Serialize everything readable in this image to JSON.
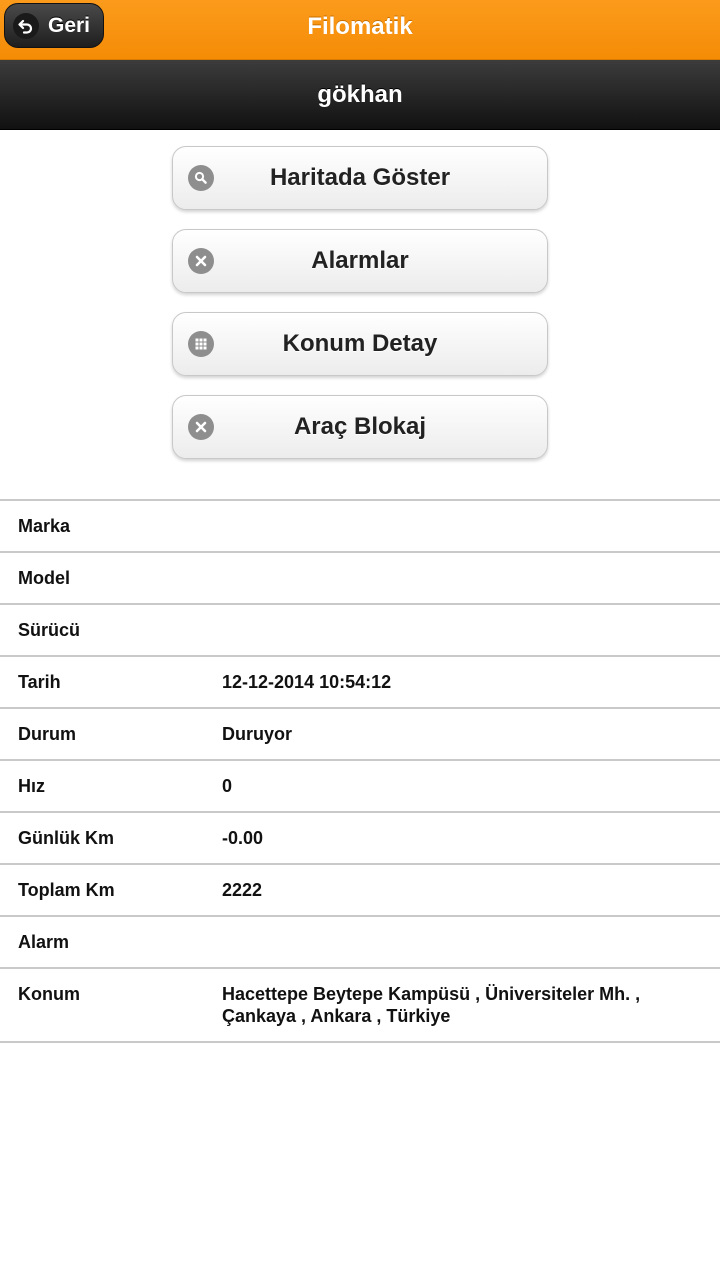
{
  "header": {
    "back_label": "Geri",
    "app_title": "Filomatik"
  },
  "subheader": {
    "title": "gökhan"
  },
  "actions": [
    {
      "label": "Haritada Göster",
      "icon": "search-icon"
    },
    {
      "label": "Alarmlar",
      "icon": "close-icon"
    },
    {
      "label": "Konum Detay",
      "icon": "grid-icon"
    },
    {
      "label": "Araç Blokaj",
      "icon": "close-icon"
    }
  ],
  "details": [
    {
      "label": "Marka",
      "value": ""
    },
    {
      "label": "Model",
      "value": ""
    },
    {
      "label": "Sürücü",
      "value": ""
    },
    {
      "label": "Tarih",
      "value": "12-12-2014 10:54:12"
    },
    {
      "label": "Durum",
      "value": "Duruyor"
    },
    {
      "label": "Hız",
      "value": "0"
    },
    {
      "label": "Günlük Km",
      "value": "-0.00"
    },
    {
      "label": "Toplam Km",
      "value": "2222"
    },
    {
      "label": "Alarm",
      "value": ""
    },
    {
      "label": "Konum",
      "value": "Hacettepe Beytepe Kampüsü , Üniversiteler Mh. , Çankaya , Ankara , Türkiye"
    }
  ]
}
